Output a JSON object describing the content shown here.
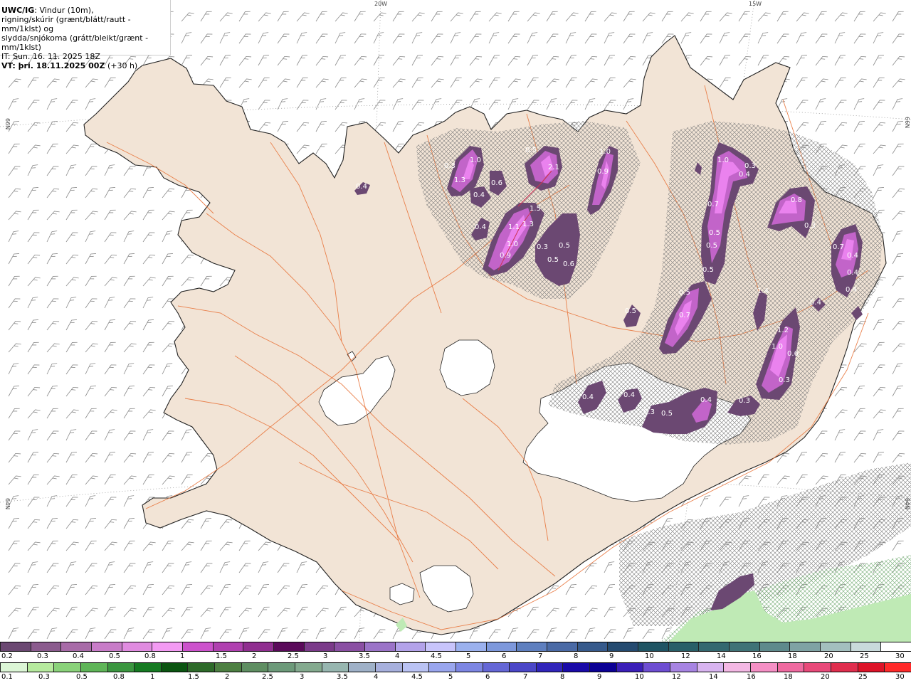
{
  "header": {
    "model": "UWC/IG",
    "line1_rest": ": Vindur (10m),",
    "line2": "rigning/skúrir (grænt/blátt/rautt - mm/1klst) og",
    "line3": "slydda/snjókoma (grátt/bleikt/grænt - mm/1klst)",
    "it": "IT: Sun. 16. 11. 2025 18Z",
    "vt": "VT: þri. 18.11.2025 00Z",
    "vt_offset": "(+30 h)"
  },
  "graticule": {
    "top_lon_20": "20W",
    "top_lon_15": "15W",
    "left_lat_66": "66N",
    "left_lat_64": "64N",
    "right_lat_66": "66N",
    "right_lat_64": "64N"
  },
  "value_labels": [
    "0.3",
    "1.0",
    "1.3",
    "0.4",
    "0.6",
    "0.5",
    "2.1",
    "1.0",
    "0.9",
    "0.4",
    "1.1",
    "1.3",
    "1.5",
    "1.0",
    "0.9",
    "0.3",
    "0.5",
    "0.5",
    "0.6",
    "0.4",
    "1.0",
    "0.4",
    "0.3",
    "0.7",
    "0.5",
    "0.5",
    "0.5",
    "0.5",
    "0.7",
    "1.4",
    "0.8",
    "0.3",
    "0.7",
    "0.4",
    "0.4",
    "0.4",
    "0.4",
    "0.5",
    "1.2",
    "1.0",
    "0.6",
    "0.3",
    "0.4",
    "0.4",
    "0.3",
    "0.5",
    "0.4",
    "0.3"
  ],
  "legend": {
    "snow_colors": [
      "#6b4872",
      "#8b5b8e",
      "#a86ba8",
      "#c87cc8",
      "#e08be0",
      "#f39af3",
      "#cc52cc",
      "#b040b0",
      "#902e90",
      "#5a0a5a",
      "#7b3a8a",
      "#8a4fa3",
      "#9b73c8",
      "#b3a2ea",
      "#c8c4fb",
      "#9bb1ee",
      "#7d98dc",
      "#5e7fbf",
      "#4a6aa6",
      "#365a8c",
      "#244a70",
      "#1f5464",
      "#285f68",
      "#336870",
      "#3f7377",
      "#5e8a8c",
      "#7fa3a4",
      "#a3bfbe",
      "#c9dadb",
      "#ffffff"
    ],
    "snow_ticks": [
      "0.2",
      "0.3",
      "0.4",
      "0.5",
      "0.8",
      "1",
      "1.5",
      "2",
      "2.5",
      "3",
      "3.5",
      "4",
      "4.5",
      "5",
      "6",
      "7",
      "8",
      "9",
      "10",
      "12",
      "14",
      "16",
      "18",
      "20",
      "25",
      "30"
    ],
    "rain_colors": [
      "#dcf6d6",
      "#b6ea9e",
      "#8ad27a",
      "#5fb558",
      "#3b9640",
      "#167a22",
      "#0b5511",
      "#2e6a2a",
      "#4d7f42",
      "#5f8e62",
      "#6d9a7a",
      "#84aa8f",
      "#97b6b0",
      "#9fb1c8",
      "#a7b0dd",
      "#bac3f4",
      "#9aa6ee",
      "#7d86e3",
      "#6567d6",
      "#4b47c8",
      "#3125ba",
      "#1a0aa8",
      "#0b0094",
      "#3b1fb8",
      "#6e4ed2",
      "#a784e2",
      "#d8b4f0",
      "#f3b8e4",
      "#f590c5",
      "#ef6aa0",
      "#e84a7a",
      "#e02e4e",
      "#dd1328",
      "#ff2a2a"
    ],
    "rain_ticks": [
      "0.1",
      "0.3",
      "0.5",
      "0.8",
      "1",
      "1.5",
      "2",
      "2.5",
      "3",
      "3.5",
      "4",
      "4.5",
      "5",
      "6",
      "7",
      "8",
      "9",
      "10",
      "12",
      "14",
      "16",
      "18",
      "20",
      "25",
      "30"
    ]
  }
}
